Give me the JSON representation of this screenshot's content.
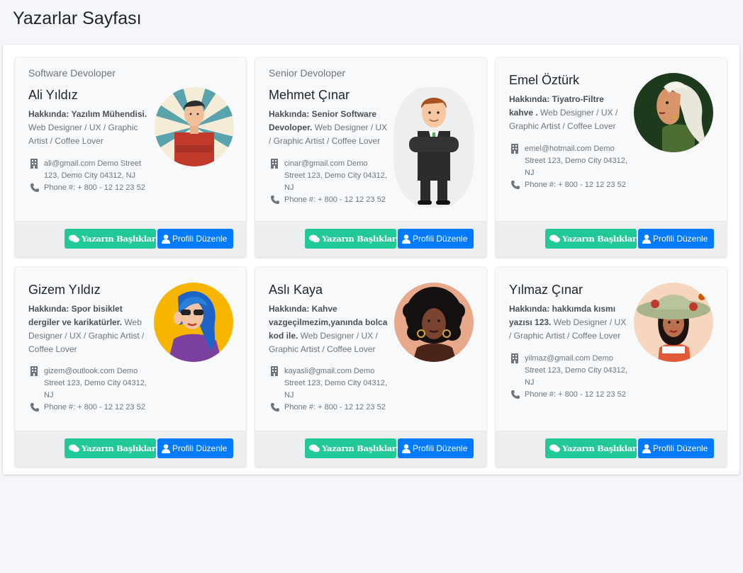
{
  "page": {
    "title": "Yazarlar Sayfası"
  },
  "buttons": {
    "posts": "Yazarın Başlıkları",
    "edit": "Profili Düzenle"
  },
  "authors": [
    {
      "role": "Software Devoloper",
      "name": "Ali Yıldız",
      "about_label": "Hakkında: Yazılım Mühendisi.",
      "about_text": " Web Designer / UX / Graphic Artist / Coffee Lover",
      "address": "ali@gmail.com Demo Street 123, Demo City 04312, NJ",
      "phone": "Phone #: + 800 - 12 12 23 52",
      "avatar_icon": "man-red-shirt-avatar"
    },
    {
      "role": "Senior Devoloper",
      "name": "Mehmet Çınar",
      "about_label": "Hakkında: Senior Software Devoloper.",
      "about_text": " Web Designer / UX / Graphic Artist / Coffee Lover",
      "address": "cinar@gmail.com Demo Street 123, Demo City 04312, NJ",
      "phone": "Phone #: + 800 - 12 12 23 52",
      "avatar_icon": "businessman-suit-avatar"
    },
    {
      "role": "",
      "name": "Emel Öztürk",
      "about_label": "Hakkında: Tiyatro-Filtre kahve .",
      "about_text": " Web Designer / UX / Graphic Artist / Coffee Lover",
      "address": "emel@hotmail.com Demo Street 123, Demo City 04312, NJ",
      "phone": "Phone #: + 800 - 12 12 23 52",
      "avatar_icon": "woman-white-hair-avatar"
    },
    {
      "role": "",
      "name": "Gizem Yıldız",
      "about_label": "Hakkında: Spor bisiklet dergiler ve karikatürler.",
      "about_text": " Web Designer / UX / Graphic Artist / Coffee Lover",
      "address": "gizem@outlook.com Demo Street 123, Demo City 04312, NJ",
      "phone": "Phone #: + 800 - 12 12 23 52",
      "avatar_icon": "woman-blue-hair-avatar"
    },
    {
      "role": "",
      "name": "Aslı Kaya",
      "about_label": "Hakkında: Kahve vazgeçilmezim,yanında bolca kod ile.",
      "about_text": " Web Designer / UX / Graphic Artist / Coffee Lover",
      "address": "kayasli@gmail.com Demo Street 123, Demo City 04312, NJ",
      "phone": "Phone #: + 800 - 12 12 23 52",
      "avatar_icon": "woman-curly-hair-avatar"
    },
    {
      "role": "",
      "name": "Yılmaz Çınar",
      "about_label": "Hakkında: hakkımda kısmı yazısı 123.",
      "about_text": " Web Designer / UX / Graphic Artist / Coffee Lover",
      "address": "yilmaz@gmail.com Demo Street 123, Demo City 04312, NJ",
      "phone": "Phone #: + 800 - 12 12 23 52",
      "avatar_icon": "woman-sun-hat-avatar"
    }
  ]
}
